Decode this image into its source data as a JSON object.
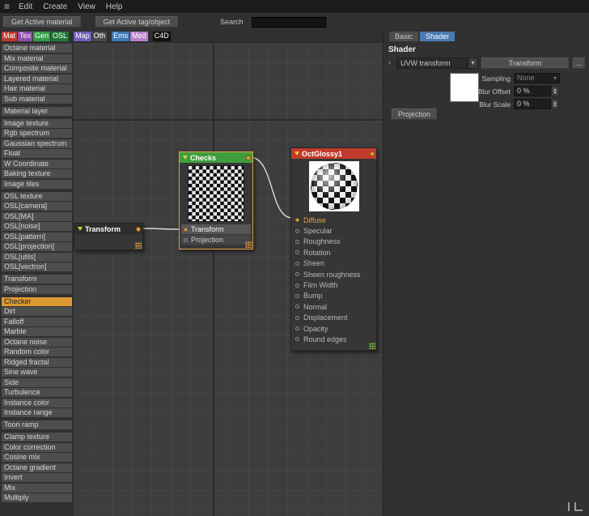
{
  "menubar": {
    "items": [
      "Edit",
      "Create",
      "View",
      "Help"
    ]
  },
  "toolbar": {
    "buttons": [
      "Get Active material",
      "Get Active tag/object"
    ],
    "search_label": "Search"
  },
  "category_tabs": [
    {
      "label": "Mat",
      "color": "#bf3a2f"
    },
    {
      "label": "Tex",
      "color": "#8a4fa8"
    },
    {
      "label": "Gen",
      "color": "#2f9e44"
    },
    {
      "label": "OSL",
      "color": "#1f7a36"
    },
    {
      "label": "Map",
      "color": "#6f5fb8",
      "gap_before": true
    },
    {
      "label": "Oth",
      "color": "#4a4a4a"
    },
    {
      "label": "Ems",
      "color": "#3b79b5",
      "gap_before": true
    },
    {
      "label": "Med",
      "color": "#b77fc9"
    },
    {
      "label": "C4D",
      "color": "#111111",
      "gap_before": true
    }
  ],
  "sidebar": {
    "selected": "Checker",
    "groups": [
      [
        "Octane material",
        "Mix material",
        "Composite material",
        "Layered material",
        "Hair material",
        "Sub material"
      ],
      [
        "Material layer"
      ],
      [
        "Image texture",
        "Rgb spectrum",
        "Gaussian spectrum",
        "Float",
        "W Coordinate",
        "Baking texture",
        "Image tiles"
      ],
      [
        "OSL texture",
        "OSL[camera]",
        "OSL[MA]",
        "OSL[noise]",
        "OSL[pattern]",
        "OSL[projection]",
        "OSL[utils]",
        "OSL[vectron]"
      ],
      [
        "Transform",
        "Projection"
      ],
      [
        "Checker",
        "Dirt",
        "Falloff",
        "Marble",
        "Octane noise",
        "Random color",
        "Ridged fractal",
        "Sine wave",
        "Side",
        "Turbulence",
        "Instance color",
        "Instance range"
      ],
      [
        "Toon ramp"
      ],
      [
        "Clamp texture",
        "Color correction",
        "Cosine mix",
        "Octane gradient",
        "Invert",
        "Mix",
        "Multiply"
      ]
    ]
  },
  "graph": {
    "transform_node": {
      "title": "Transform"
    },
    "checks_node": {
      "title": "Checks",
      "inputs": [
        {
          "label": "Transform",
          "connected": true
        },
        {
          "label": "Projection",
          "connected": false
        }
      ]
    },
    "octglossy_node": {
      "title": "OctGlossy1",
      "params": [
        {
          "label": "Diffuse",
          "connected": true
        },
        {
          "label": "Specular"
        },
        {
          "label": "Roughness"
        },
        {
          "label": "Rotation"
        },
        {
          "label": "Sheen"
        },
        {
          "label": "Sheen roughness"
        },
        {
          "label": "Film Width"
        },
        {
          "label": "Bump"
        },
        {
          "label": "Normal"
        },
        {
          "label": "Displacement"
        },
        {
          "label": "Opacity"
        },
        {
          "label": "Round edges"
        }
      ]
    },
    "accent_colors": {
      "port": "#e6a23c",
      "checks_header": "#3f9e3c",
      "octglossy_header": "#c23a2c",
      "selection": "#e6a23c"
    }
  },
  "inspector": {
    "tabs": [
      {
        "label": "Basic",
        "active": false
      },
      {
        "label": "Shader",
        "active": true
      }
    ],
    "section_title": "Shader",
    "rows": {
      "uvw_label": "UVW transform",
      "transform_button": "Transform",
      "more_button": "...",
      "sampling_label": "Sampling",
      "sampling_value": "None",
      "blur_offset_label": "Blur Offset",
      "blur_offset_value": "0 %",
      "blur_scale_label": "Blur Scale",
      "blur_scale_value": "0 %",
      "projection_button": "Projection"
    }
  }
}
